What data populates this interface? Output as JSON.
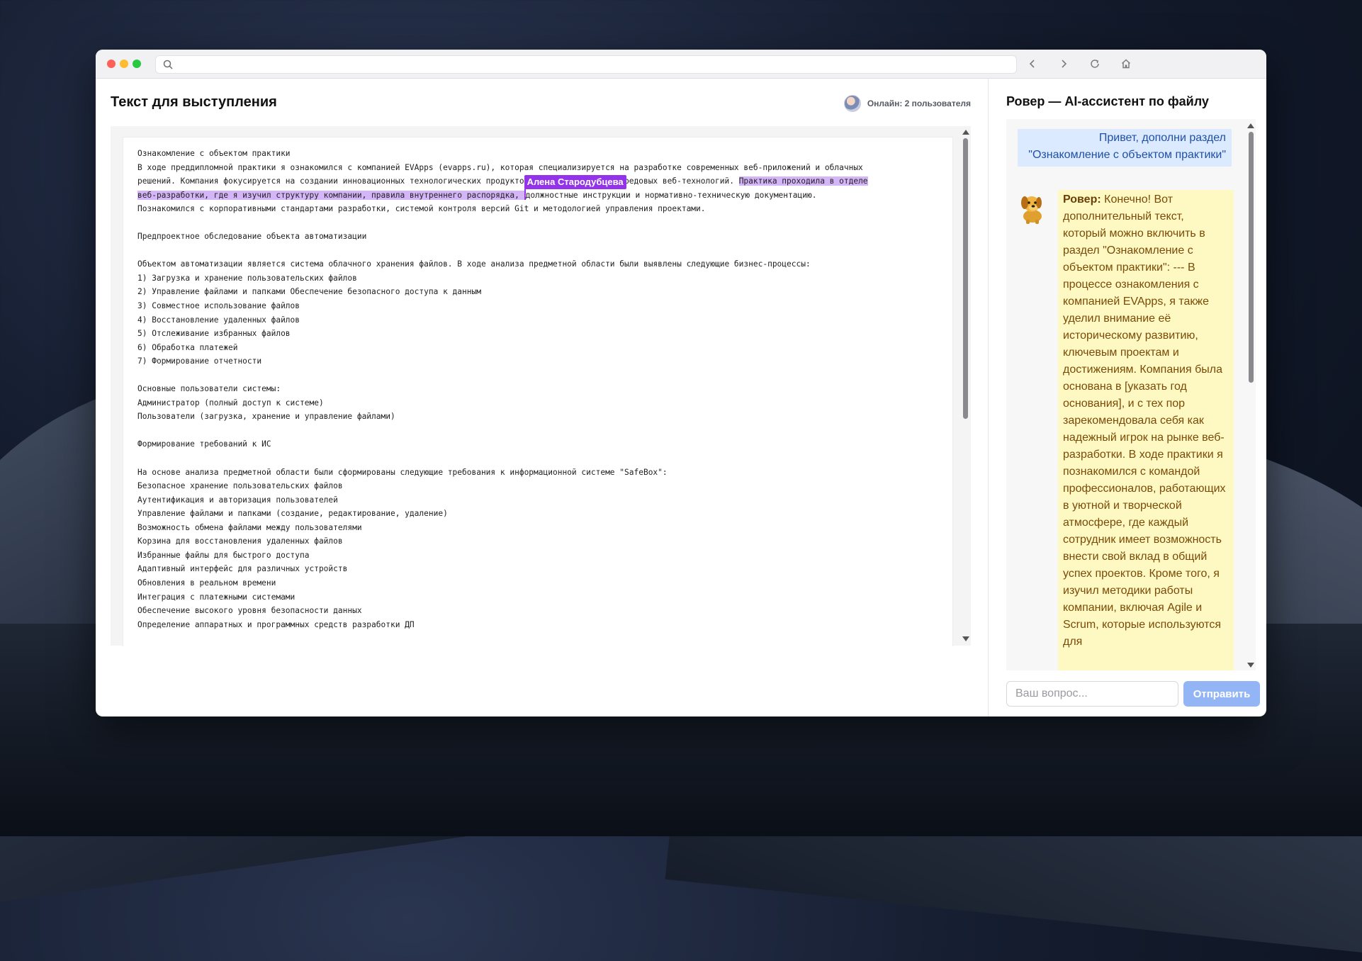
{
  "browser": {
    "search_placeholder": "",
    "icons": [
      "search-icon",
      "back-icon",
      "forward-icon",
      "reload-icon",
      "home-icon"
    ]
  },
  "document": {
    "title": "Текст для выступления",
    "online_label": "Онлайн: 2 пользователя",
    "collaborator_cursor_name": "Алена Стародубцева",
    "line_1": "Ознакомление с объектом практики",
    "line_2": "В ходе преддипломной практики я ознакомился с компанией EVApps (evapps.ru), которая специализируется на разработке современных веб-приложений и облачных",
    "line_3_before": "решений. Компания фокусируется на создании инновационных технологических продукто",
    "line_3_middle": "в с использованием передовых веб-технологий. ",
    "line_3_highlight": "Практика проходила в отделе",
    "line_4_highlight": "веб-разработки, где я изучил структуру компании, правила внутреннего распорядка, ",
    "line_4_after": "должностные инструкции и нормативно-техническую документацию.",
    "line_5": "Познакомился с корпоративными стандартами разработки, системой контроля версий Git и методологией управления проектами.",
    "line_6": "",
    "line_7": "Предпроектное обследование объекта автоматизации",
    "line_8": "",
    "line_9": "Объектом автоматизации является система облачного хранения файлов. В ходе анализа предметной области были выявлены следующие бизнес-процессы:",
    "line_10": "1) Загрузка и хранение пользовательских файлов",
    "line_11": "2) Управление файлами и папками Обеспечение безопасного доступа к данным",
    "line_12": "3) Совместное использование файлов",
    "line_13": "4) Восстановление удаленных файлов",
    "line_14": "5) Отслеживание избранных файлов",
    "line_15": "6) Обработка платежей",
    "line_16": "7) Формирование отчетности",
    "line_17": "",
    "line_18": "Основные пользователи системы:",
    "line_19": "Администратор (полный доступ к системе)",
    "line_20": "Пользователи (загрузка, хранение и управление файлами)",
    "line_21": "",
    "line_22": "Формирование требований к ИС",
    "line_23": "",
    "line_24": "На основе анализа предметной области были сформированы следующие требования к информационной системе \"SafeBox\":",
    "line_25": "Безопасное хранение пользовательских файлов",
    "line_26": "Аутентификация и авторизация пользователей",
    "line_27": "Управление файлами и папками (создание, редактирование, удаление)",
    "line_28": "Возможность обмена файлами между пользователями",
    "line_29": "Корзина для восстановления удаленных файлов",
    "line_30": "Избранные файлы для быстрого доступа",
    "line_31": "Адаптивный интерфейс для различных устройств",
    "line_32": "Обновления в реальном времени",
    "line_33": "Интеграция с платежными системами",
    "line_34": "Обеспечение высокого уровня безопасности данных",
    "line_35": "Определение аппаратных и программных средств разработки ДП"
  },
  "assistant": {
    "title": "Ровер — AI-ассистент по файлу",
    "user_message": "Привет, дополни раздел \"Ознакомление с объектом практики\"",
    "bot_name": "Ровер:",
    "bot_message": " Конечно! Вот дополнительный текст, который можно включить в раздел \"Ознакомление с объектом практики\": --- В процессе ознакомления с компанией EVApps, я также уделил внимание её историческому развитию, ключевым проектам и достижениям. Компания была основана в [указать год основания], и с тех пор зарекомендовала себя как надежный игрок на рынке веб-разработки. В ходе практики я познакомился с командой профессионалов, работающих в уютной и творческой атмосфере, где каждый сотрудник имеет возможность внести свой вклад в общий успех проектов. Кроме того, я изучил методики работы компании, включая Agile и Scrum, которые используются для",
    "input_placeholder": "Ваш вопрос...",
    "send_label": "Отправить"
  },
  "colors": {
    "selection_highlight": "#d4b5f7",
    "collaborator_cursor": "#9333ea",
    "user_bubble": "#dbeafe",
    "bot_bubble": "#fef9c3",
    "send_button": "#93b4f5"
  }
}
